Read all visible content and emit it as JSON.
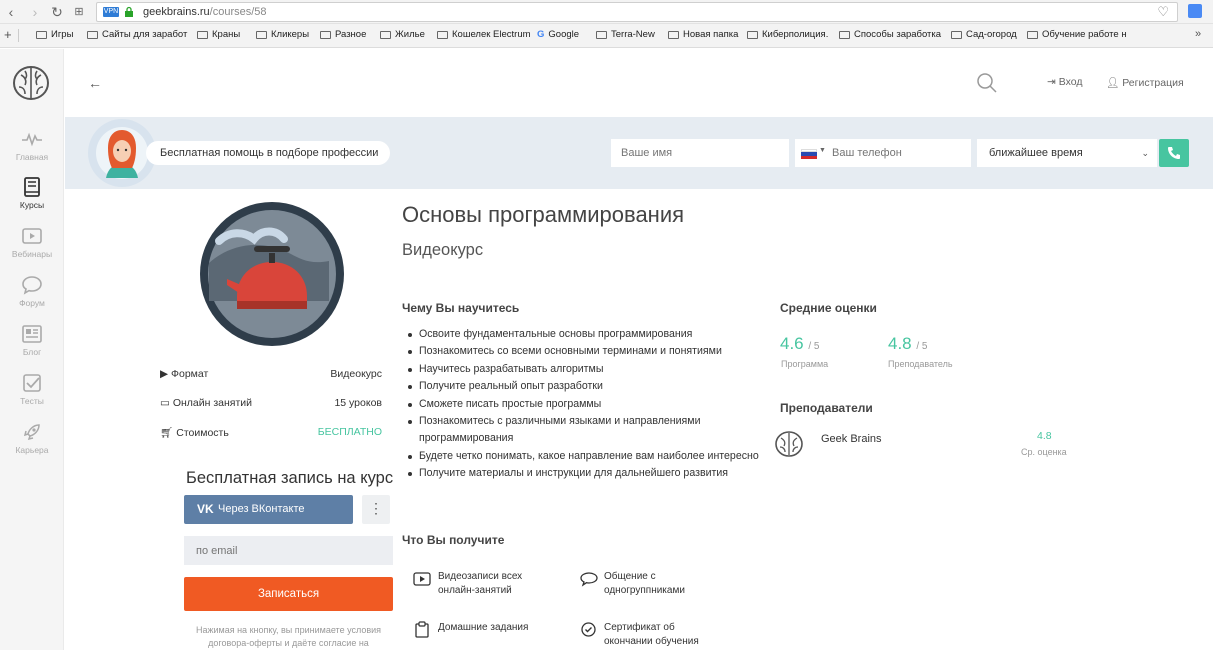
{
  "browser": {
    "url_domain": "geekbrains.ru",
    "url_path": "/courses/58",
    "vpn_label": "VPN",
    "bookmarks": [
      "Игры",
      "Сайты для заработ",
      "Краны",
      "Кликеры",
      "Разное",
      "Жилье",
      "Кошелек Electrum",
      "Google",
      "Terra-New",
      "Новая папка",
      "Киберполиция.",
      "Способы заработка",
      "Сад-огород",
      "Обучение работе н"
    ],
    "overflow": "»"
  },
  "sidebar": {
    "items": [
      {
        "label": "Главная",
        "icon": "pulse-icon"
      },
      {
        "label": "Курсы",
        "icon": "book-icon"
      },
      {
        "label": "Вебинары",
        "icon": "play-icon"
      },
      {
        "label": "Форум",
        "icon": "chat-icon"
      },
      {
        "label": "Блог",
        "icon": "news-icon"
      },
      {
        "label": "Тесты",
        "icon": "check-icon"
      },
      {
        "label": "Карьера",
        "icon": "rocket-icon"
      }
    ]
  },
  "header": {
    "back": "←",
    "login": "Вход",
    "register": "Регистрация"
  },
  "consult": {
    "text": "Бесплатная помощь в подборе профессии",
    "name_placeholder": "Ваше имя",
    "phone_placeholder": "Ваш телефон",
    "time_value": "ближайшее время"
  },
  "course": {
    "title": "Основы программирования",
    "subtitle": "Видеокурс",
    "meta": [
      {
        "label": "Формат",
        "value": "Видеокурс"
      },
      {
        "label": "Онлайн занятий",
        "value": "15 уроков"
      },
      {
        "label": "Стоимость",
        "value": "БЕСПЛАТНО"
      }
    ],
    "learn_heading": "Чему Вы научитесь",
    "learn_items": [
      "Освоите фундаментальные основы программирования",
      "Познакомитесь со всеми основными терминами и понятиями",
      "Научитесь разрабатывать алгоритмы",
      "Получите реальный опыт разработки",
      "Сможете писать простые программы",
      "Познакомитесь с различными языками и направлениями программирования",
      "Будете четко понимать, какое направление вам наиболее интересно",
      "Получите материалы и инструкции для дальнейшего развития"
    ],
    "get_heading": "Что Вы получите",
    "get_items": [
      {
        "text": "Видеозаписи всех онлайн-занятий",
        "icon": "video-icon"
      },
      {
        "text": "Общение с одногруппниками",
        "icon": "chat-bubble-icon"
      },
      {
        "text": "Домашние задания",
        "icon": "homework-icon"
      },
      {
        "text": "Сертификат об окончании обучения",
        "icon": "certificate-icon"
      }
    ]
  },
  "enroll": {
    "title": "Бесплатная запись на курс",
    "vk_label": "Через ВКонтакте",
    "more": "⋮",
    "email_placeholder": "по email",
    "submit": "Записаться",
    "disclaimer": "Нажимая на кнопку, вы принимаете условия договора-оферты и даёте согласие на"
  },
  "ratings": {
    "heading": "Средние оценки",
    "program": {
      "value": "4.6",
      "max": "/ 5",
      "label": "Программа"
    },
    "teacher": {
      "value": "4.8",
      "max": "/ 5",
      "label": "Преподаватель"
    },
    "teachers_heading": "Преподаватели",
    "teacher_name": "Geek Brains",
    "teacher_score": "4.8",
    "teacher_score_label": "Ср. оценка"
  },
  "colors": {
    "accent": "#47c5a0",
    "orange": "#f05a23",
    "vk": "#5e7fa6"
  }
}
